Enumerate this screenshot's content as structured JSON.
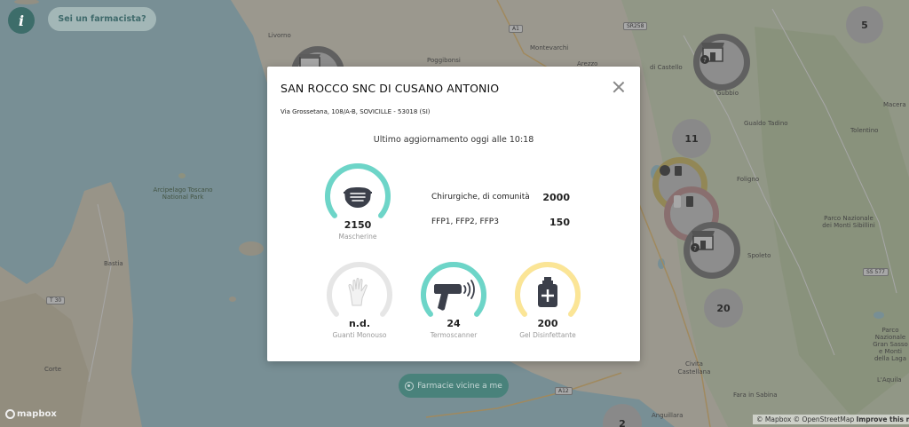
{
  "map": {
    "labels": {
      "livorno": "Livorno",
      "poggibonsi": "Poggibonsi",
      "montevarchi": "Montevarchi",
      "arezzo": "Arezzo",
      "castello": "di Castello",
      "gubbio": "Gubbio",
      "gualdo": "Gualdo Tadino",
      "macerata": "Macera",
      "tolentino": "Tolentino",
      "foligno": "Foligno",
      "spoleto": "Spoleto",
      "parco": "Parco Nazionale dei Monti Sibillini",
      "arcipelago": "Arcipelago Toscano National Park",
      "bastia": "Bastia",
      "corte": "Corte",
      "civita": "Civita Castellana",
      "farfa": "Fara in Sabina",
      "aquila": "L'Aquila",
      "monti_laga": "Parco Nazionale Gran Sasso e Monti della Laga",
      "anguillara": "Anguillara"
    },
    "shields": {
      "a1": "A1",
      "sr258": "SR258",
      "a12": "A12",
      "t30": "T 30",
      "ss577": "SS 577"
    }
  },
  "controls": {
    "info_label": "i",
    "pharmacist_label": "Sei un farmacista?",
    "nearby_label": "Farmacie vicine a me",
    "mapbox_label": "mapbox",
    "attribution_mapbox": "© Mapbox",
    "attribution_osm": "© OpenStreetMap",
    "attribution_improve": "Improve this map"
  },
  "clusters": [
    {
      "id": "c5",
      "count": "5"
    },
    {
      "id": "c11",
      "count": "11"
    },
    {
      "id": "c20",
      "count": "20"
    },
    {
      "id": "c2",
      "count": "2"
    }
  ],
  "pharmacy": {
    "name": "SAN ROCCO SNC DI CUSANO ANTONIO",
    "address": "Via Grossetana, 108/A-B, SOVICILLE - 53018 (SI)",
    "updated": "Ultimo aggiornamento oggi alle 10:18",
    "masks": {
      "value": "2150",
      "label": "Mascherine",
      "level": 1.0,
      "breakdown": [
        {
          "name": "Chirurgiche, di comunità",
          "value": "2000"
        },
        {
          "name": "FFP1, FFP2, FFP3",
          "value": "150"
        }
      ]
    },
    "items": [
      {
        "key": "gloves",
        "value": "n.d.",
        "label": "Guanti Monouso",
        "level": 0.0
      },
      {
        "key": "thermoscanner",
        "value": "24",
        "label": "Termoscanner",
        "level": 1.0
      },
      {
        "key": "gel",
        "value": "200",
        "label": "Gel Disinfettante",
        "level": 1.0
      }
    ]
  },
  "colors": {
    "accent_teal": "#6dd5c8",
    "gel_yellow": "#fbe596",
    "empty_gray": "#e6e6e6",
    "icon_dark": "#3b3f4a"
  }
}
